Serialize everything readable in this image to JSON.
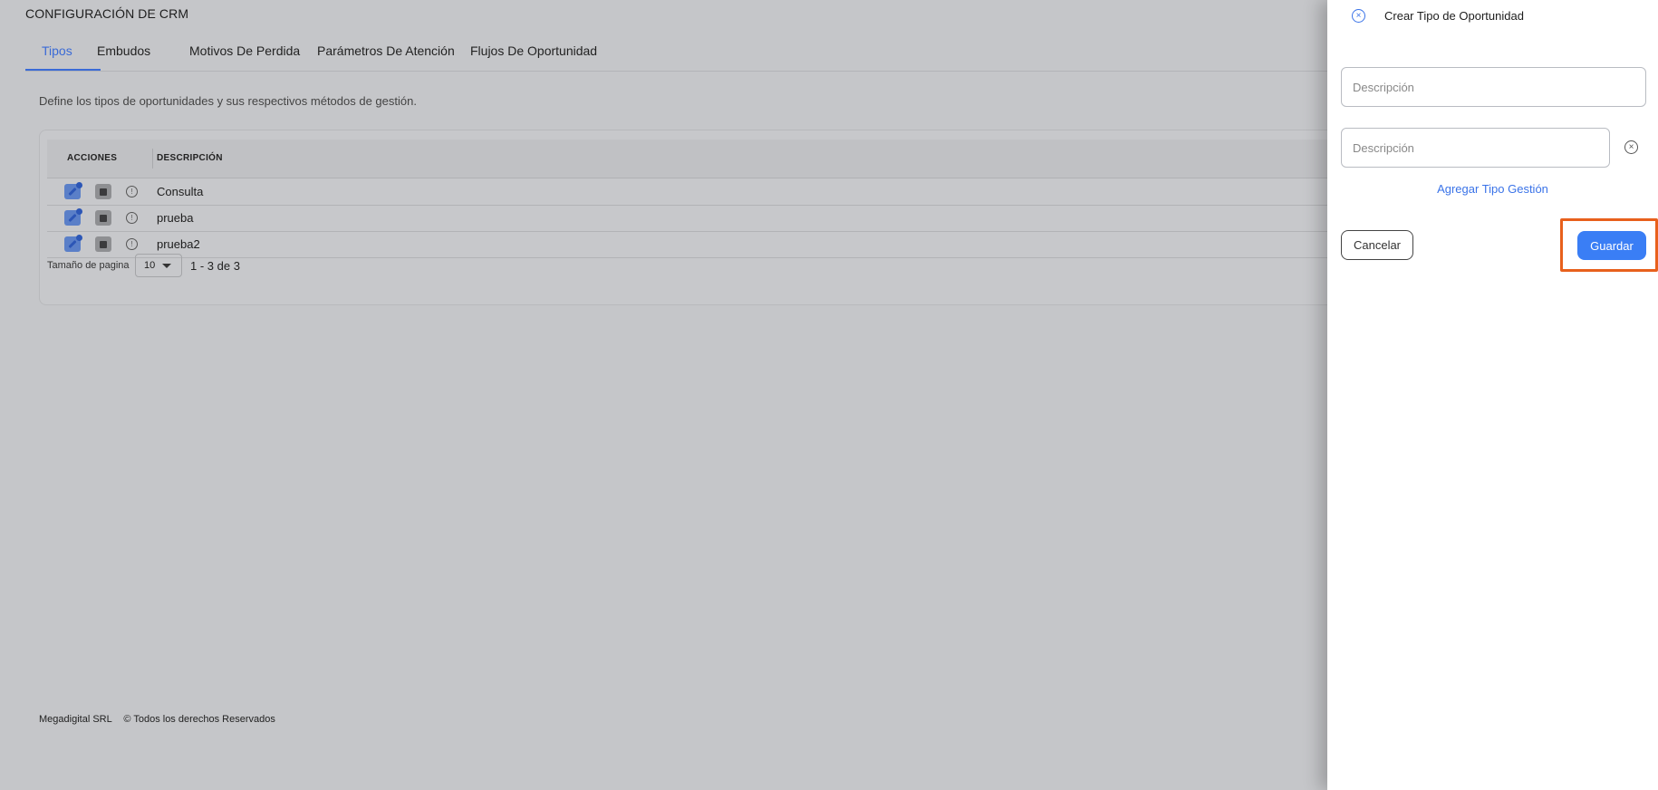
{
  "page": {
    "title": "CONFIGURACIÓN DE CRM",
    "tabs": [
      "Tipos",
      "Embudos",
      "Motivos De Perdida",
      "Parámetros De Atención",
      "Flujos De Oportunidad"
    ],
    "active_tab": "Tipos",
    "description": "Define los tipos de oportunidades y sus respectivos métodos de gestión."
  },
  "table": {
    "headers": {
      "actions": "ACCIONES",
      "description": "DESCRIPCIÓN"
    },
    "rows": [
      {
        "description": "Consulta"
      },
      {
        "description": "prueba"
      },
      {
        "description": "prueba2"
      }
    ],
    "info_icon": "info-icon"
  },
  "pagination": {
    "page_size_label": "Tamaño de pagina",
    "page_size": "10",
    "range": "1 - 3 de 3"
  },
  "footer": {
    "company": "Megadigital SRL",
    "rights": "© Todos los derechos Reservados"
  },
  "drawer": {
    "title": "Crear Tipo de Oportunidad",
    "description_placeholder": "Descripción",
    "management_type_placeholder": "Descripción",
    "add_link": "Agregar Tipo Gestión",
    "cancel_label": "Cancelar",
    "save_label": "Guardar"
  },
  "colors": {
    "accent": "#3a73e8",
    "save_button": "#3a7ef5",
    "highlight": "#e8601c",
    "overlay": "#c5c6c9"
  }
}
